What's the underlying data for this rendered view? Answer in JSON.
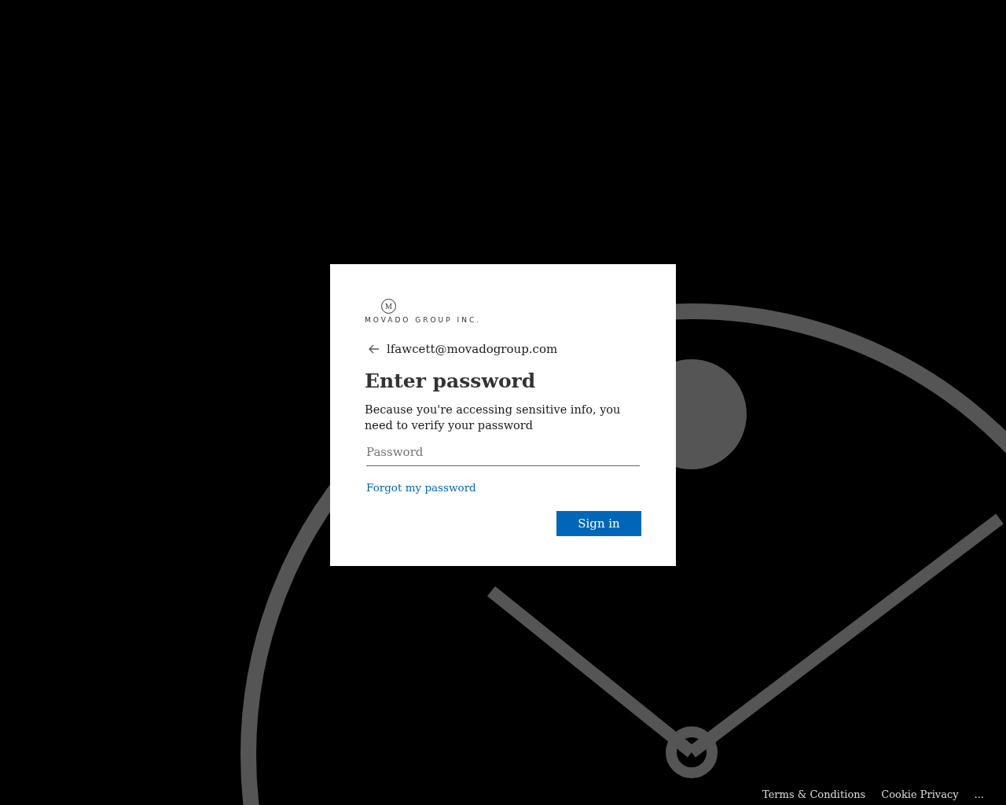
{
  "logo": {
    "monogram": "M",
    "wordmark": "MOVADO GROUP INC."
  },
  "account": {
    "email": "lfawcett@movadogroup.com"
  },
  "title": "Enter password",
  "description": "Because you're accessing sensitive info, you need to verify your password",
  "password_field": {
    "placeholder": "Password"
  },
  "forgot_link": "Forgot my password",
  "sign_in_button": "Sign in",
  "footer_links": [
    "Terms & Conditions",
    "Cookie Privacy",
    "..."
  ]
}
